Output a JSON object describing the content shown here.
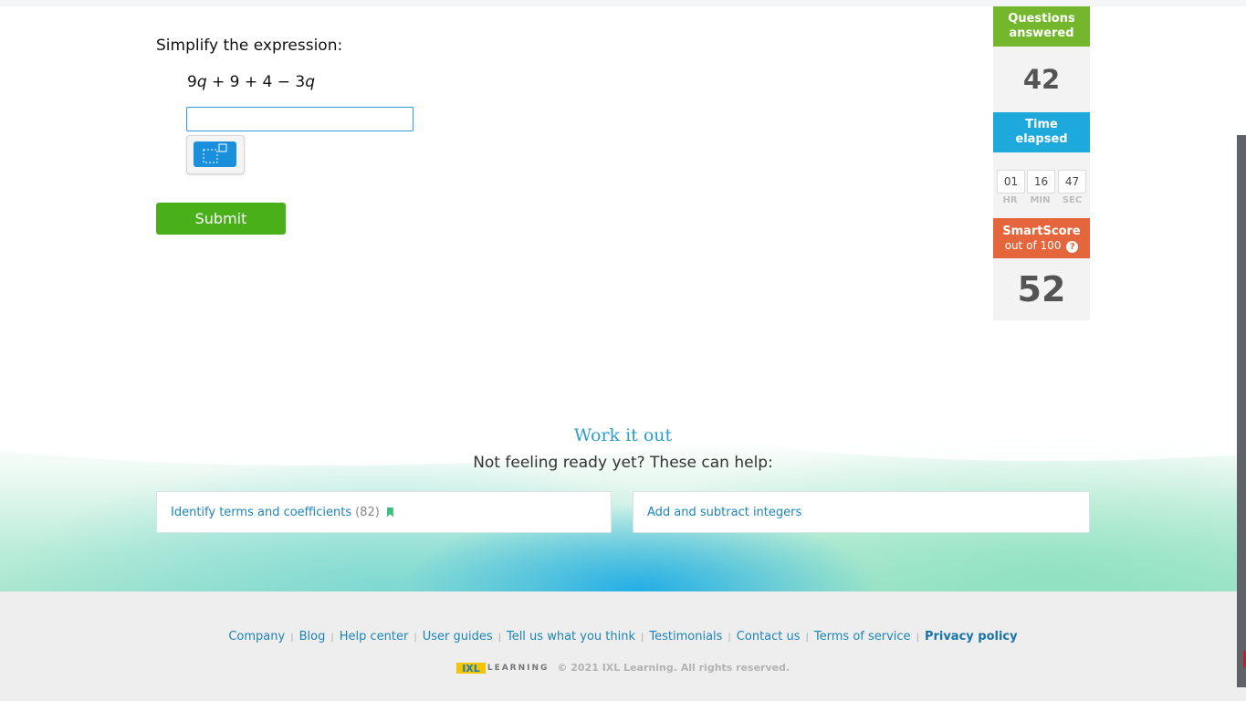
{
  "question": {
    "prompt": "Simplify the expression:",
    "expression": {
      "t1": "9",
      "var1": "q",
      "rest": " + 9 + 4 − 3",
      "var2": "q"
    },
    "answer_value": "",
    "submit_label": "Submit"
  },
  "stats": {
    "questions_answered_label": "Questions answered",
    "questions_answered": "42",
    "time_elapsed_label": "Time elapsed",
    "timer": {
      "hr": "01",
      "min": "16",
      "sec": "47",
      "hr_label": "HR",
      "min_label": "MIN",
      "sec_label": "SEC"
    },
    "smartscore_label": "SmartScore",
    "smartscore_sub": "out of 100",
    "help_glyph": "?",
    "smartscore": "52"
  },
  "work_it_out": {
    "title": "Work it out",
    "subtitle": "Not feeling ready yet? These can help:",
    "cards": [
      {
        "label": "Identify terms and coefficients",
        "count": "(82)",
        "icon": "bookmark-icon"
      },
      {
        "label": "Add and subtract integers"
      }
    ]
  },
  "footer": {
    "links": [
      "Company",
      "Blog",
      "Help center",
      "User guides",
      "Tell us what you think",
      "Testimonials",
      "Contact us",
      "Terms of service",
      "Privacy policy"
    ],
    "separator": "|",
    "logo_text": "IXL",
    "learning_text": "LEARNING",
    "copyright": "© 2021 IXL Learning. All rights reserved."
  },
  "colors": {
    "green": "#74b72c",
    "blue": "#1ea9dc",
    "orange": "#e5663c",
    "submit": "#4ab01a",
    "link": "#1d84b8"
  }
}
